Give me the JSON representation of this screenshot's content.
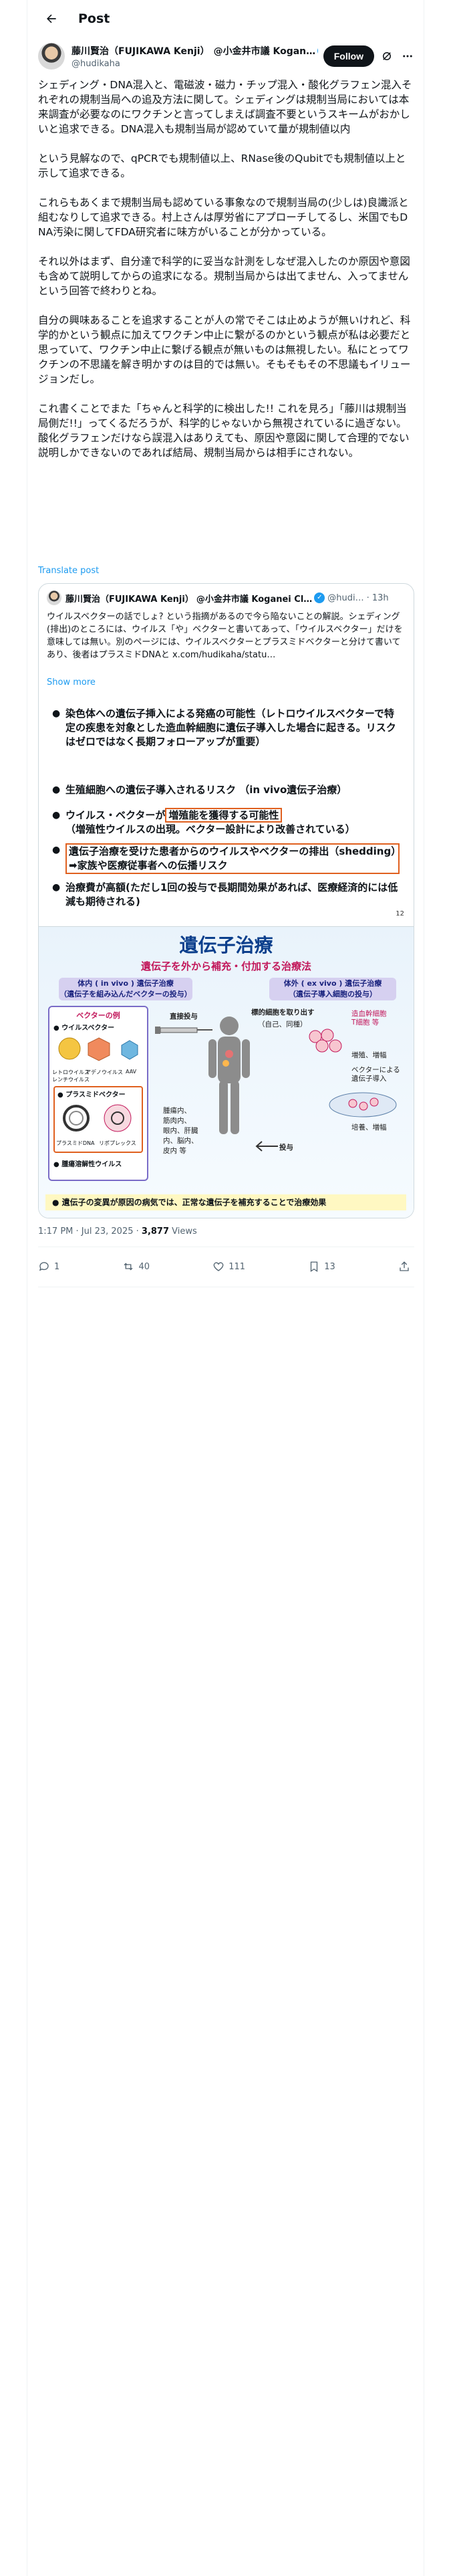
{
  "header": {
    "title": "Post"
  },
  "author": {
    "name": "藤川賢治（FUJIKAWA Kenji）",
    "affiliation": "@小金井市議 Kogan…",
    "handle": "@hudikaha",
    "follow_label": "Follow"
  },
  "post": {
    "paragraphs": [
      "シェディング・DNA混入と、電磁波・磁力・チップ混入・酸化グラフェン混入それぞれの規制当局への追及方法に関して。シェディングは規制当局においては本来調査が必要なのにワクチンと言ってしまえば調査不要というスキームがおかしいと追求できる。DNA混入も規制当局が認めていて量が規制値以内",
      "という見解なので、qPCRでも規制値以上、RNase後のQubitでも規制値以上と示して追求できる。",
      "これらもあくまで規制当局も認めている事象なので規制当局の(少しは)良識派と組むなりして追求できる。村上さんは厚労省にアプローチしてるし、米国でもDNA汚染に関してFDA研究者に味方がいることが分かっている。",
      "それ以外はまず、自分達で科学的に妥当な計測をしなぜ混入したのか原因や意図も含めて説明してからの追求になる。規制当局からは出てません、入ってませんという回答で終わりとね。",
      "自分の興味あることを追求することが人の常でそこは止めようが無いけれど、科学的かという観点に加えてワクチン中止に繋がるのかという観点が私は必要だと思っていて、ワクチン中止に繋げる観点が無いものは無視したい。私にとってワクチンの不思議を解き明かすのは目的では無い。そもそもその不思議もイリュージョンだし。",
      "これ書くことでまた「ちゃんと科学的に検出した!! これを見ろ」「藤川は規制当局側だ!!」ってくるだろうが、科学的じゃないから無視されているに過ぎない。酸化グラフェンだけなら誤混入はありえても、原因や意図に関して合理的でない説明しかできないのであれば結局、規制当局からは相手にされない。"
    ],
    "translate_label": "Translate post",
    "timestamp": "1:17 PM · Jul 23, 2025",
    "views_count": "3,877",
    "views_label": "Views"
  },
  "quote": {
    "name": "藤川賢治（FUJIKAWA Kenji）",
    "affiliation": "@小金井市議 Koganei Cl…",
    "handle": "@hudi…",
    "age": "· 13h",
    "text": "ウイルスベクターの話でしょ? という指摘があるので今ら陥ないことの解説。シェディング(排出)のところには、ウイルス「や」ベクターと書いてあって、「ウイルスベクター」だけを意味しては無い。別のページには、ウイルスベクターとプラスミドベクターと分けて書いてあり、後者はプラスミドDNAと x.com/hudikaha/statu…",
    "show_more": "Show more",
    "slide1": {
      "bullets": [
        "染色体への遺伝子挿入による発癌の可能性（レトロウイルスベクターで特定の疾患を対象とした造血幹細胞に遺伝子導入した場合に起きる。リスクはゼロではなく長期フォローアップが重要）",
        "生殖細胞への遺伝子導入されるリスク （in vivo遺伝子治療）",
        "ウイルス・ベクターが",
        "増殖能を獲得する可能性",
        "（増殖性ウイルスの出現。ベクター設計により改善されている）",
        "遺伝子治療を受けた患者からのウイルスやベクターの排出（shedding）　➡家族や医療従事者への伝播リスク",
        "治療費が高額(ただし1回の投与で長期間効果があれば、医療経済的には低減も期待される)"
      ],
      "page_number": "12"
    },
    "slide2": {
      "title": "遺伝子治療",
      "subtitle": "遺伝子を外から補充・付加する治療法",
      "box_left": "体内 ( in vivo ) 遺伝子治療\n（遺伝子を組み込んだベクターの投与）",
      "box_right": "体外 ( ex vivo ) 遺伝子治療\n（遺伝子導入細胞の投与）",
      "vector_header": "ベクターの例",
      "vectors": [
        "● ウイルスベクター",
        "レトロウイルス\nレンチウイルス",
        "アデノウイルス",
        "AAV",
        "● プラスミドベクター",
        "プラスミドDNA",
        "リポプレックス",
        "● 腫瘍溶解性ウイルス"
      ],
      "labels": [
        "直接投与",
        "標的細胞を取り出す",
        "（自己、同種）",
        "造血幹細胞\nT細胞 等",
        "増殖、増幅",
        "ベクターによる\n遺伝子導入",
        "培養、増幅",
        "投与",
        "腫瘍内、\n筋肉内、\n眼内、肝臓\n内、脳内、\n皮内 等"
      ],
      "footer": "●  遺伝子の変異が原因の病気では、正常な遺伝子を補充することで治療効果"
    }
  },
  "actions": {
    "reply_count": "1",
    "repost_count": "40",
    "like_count": "111",
    "bookmark_count": "13"
  }
}
